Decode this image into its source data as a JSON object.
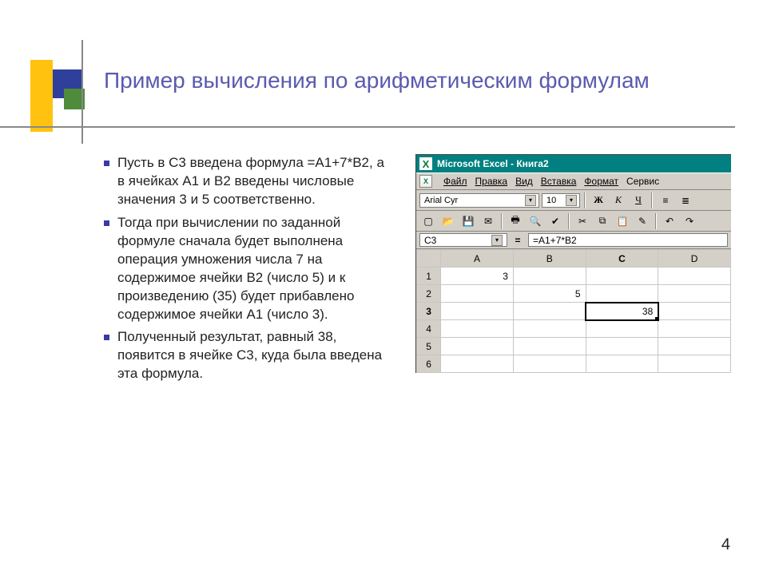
{
  "title": "Пример вычисления по арифметическим формулам",
  "bullets": [
    "Пусть в С3 введена формула =А1+7*В2, а в ячейках А1 и В2 введены числовые значения 3 и 5 соответственно.",
    "Тогда при вычислении по заданной формуле сначала будет выполнена операция умножения числа 7 на содержимое ячейки В2 (число 5) и к произведению (35) будет прибавлено содержимое ячейки А1 (число 3).",
    "Полученный результат, равный 38, появится в ячейке С3, куда была введена эта формула."
  ],
  "page_number": "4",
  "excel": {
    "app_title": "Microsoft Excel - Книга2",
    "menus": {
      "file": "Файл",
      "edit": "Правка",
      "view": "Вид",
      "insert": "Вставка",
      "format": "Формат",
      "service": "Сервис"
    },
    "font_name": "Arial Cyr",
    "font_size": "10",
    "style": {
      "bold": "Ж",
      "italic": "К",
      "underline": "Ч"
    },
    "name_box": "C3",
    "formula": "=A1+7*B2",
    "columns": [
      "A",
      "B",
      "C",
      "D"
    ],
    "rows": [
      "1",
      "2",
      "3",
      "4",
      "5",
      "6"
    ],
    "cells": {
      "A1": "3",
      "B2": "5",
      "C3": "38"
    },
    "selected_col": "C",
    "selected_row": "3"
  }
}
